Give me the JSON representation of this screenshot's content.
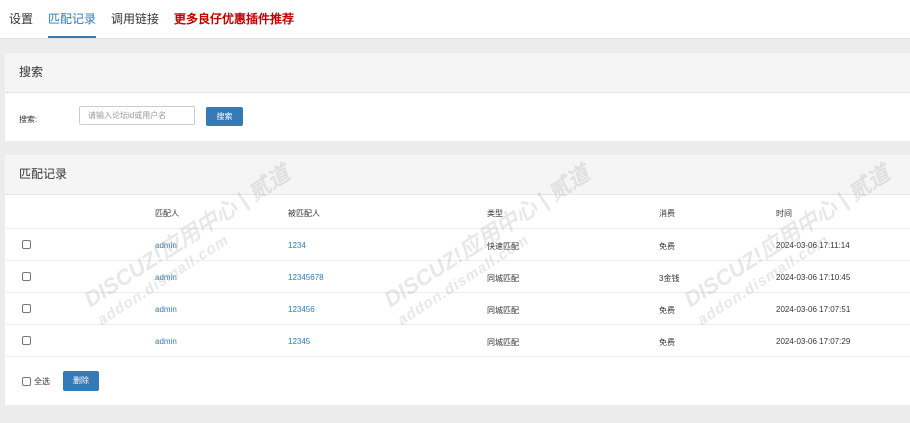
{
  "tabs": [
    {
      "label": "设置"
    },
    {
      "label": "匹配记录"
    },
    {
      "label": "调用链接"
    },
    {
      "label": "更多良仔优惠插件推荐"
    }
  ],
  "search_panel": {
    "title": "搜索",
    "label": "搜索:",
    "placeholder": "请输入论坛id或用户名",
    "button": "搜索"
  },
  "records_panel": {
    "title": "匹配记录",
    "columns": [
      "匹配人",
      "被匹配人",
      "类型",
      "消费",
      "时间"
    ],
    "rows": [
      {
        "matcher": "admin",
        "matched": "1234",
        "type": "快速匹配",
        "cost": "免费",
        "time": "2024-03-06 17:11:14"
      },
      {
        "matcher": "admin",
        "matched": "12345678",
        "type": "同城匹配",
        "cost": "3金钱",
        "time": "2024-03-06 17:10:45"
      },
      {
        "matcher": "admin",
        "matched": "123456",
        "type": "同城匹配",
        "cost": "免费",
        "time": "2024-03-06 17:07:51"
      },
      {
        "matcher": "admin",
        "matched": "12345",
        "type": "同城匹配",
        "cost": "免费",
        "time": "2024-03-06 17:07:29"
      }
    ],
    "select_all_label": "全选",
    "delete_button": "删除"
  },
  "watermark": {
    "line1": "DISCUZ!应用中心 | 贰道",
    "line2": "addon.dismall.com"
  },
  "colors": {
    "accent": "#337ab7",
    "promo": "#c40000",
    "background": "#ececec"
  }
}
